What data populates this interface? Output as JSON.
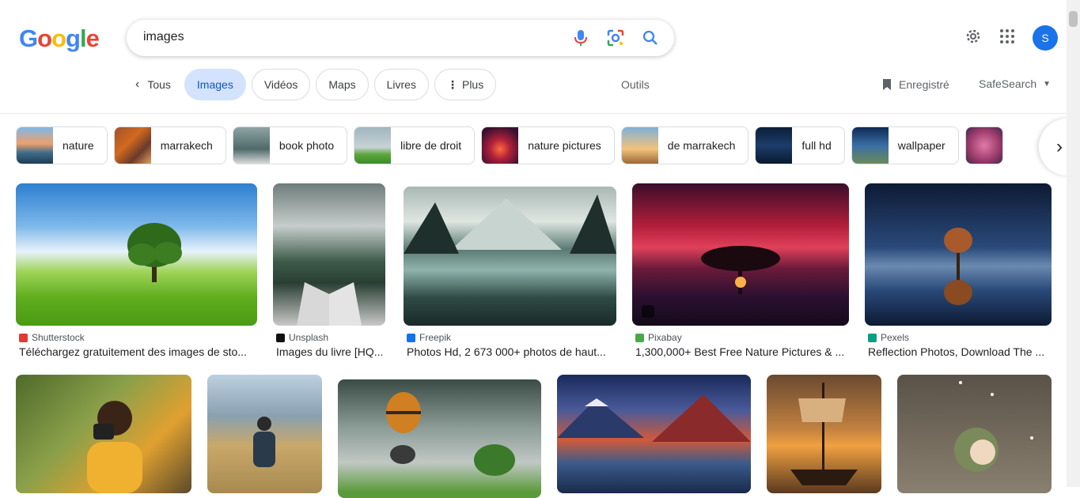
{
  "search": {
    "query": "images"
  },
  "logo": [
    "G",
    "o",
    "o",
    "g",
    "l",
    "e"
  ],
  "user": {
    "initial": "S"
  },
  "tabs": {
    "all": "Tous",
    "images": "Images",
    "videos": "Vidéos",
    "maps": "Maps",
    "books": "Livres",
    "more": "Plus"
  },
  "tools": {
    "outils": "Outils",
    "saved": "Enregistré",
    "safesearch": "SafeSearch"
  },
  "chips": [
    {
      "label": "nature"
    },
    {
      "label": "marrakech"
    },
    {
      "label": "book photo"
    },
    {
      "label": "libre de droit"
    },
    {
      "label": "nature pictures"
    },
    {
      "label": "de marrakech"
    },
    {
      "label": "full hd"
    },
    {
      "label": "wallpaper"
    }
  ],
  "results": [
    {
      "source": "Shutterstock",
      "title": "Téléchargez gratuitement des images de sto..."
    },
    {
      "source": "Unsplash",
      "title": "Images du livre [HQ..."
    },
    {
      "source": "Freepik",
      "title": "Photos Hd, 2 673 000+ photos de haut..."
    },
    {
      "source": "Pixabay",
      "title": "1,300,000+ Best Free Nature Pictures & ..."
    },
    {
      "source": "Pexels",
      "title": "Reflection Photos, Download The ..."
    }
  ],
  "colors": {
    "accent": "#0b57d0",
    "active_tab_bg": "#d3e3fd",
    "avatar": "#1a73e8"
  }
}
